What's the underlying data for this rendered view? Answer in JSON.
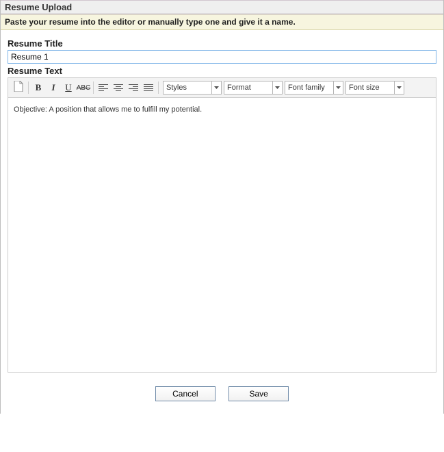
{
  "header": {
    "title": "Resume Upload"
  },
  "instruction": "Paste your resume into the editor or manually type one and give it a name.",
  "form": {
    "title_label": "Resume Title",
    "title_value": "Resume 1",
    "text_label": "Resume Text"
  },
  "toolbar": {
    "new_doc": "New Document",
    "bold": "B",
    "italic": "I",
    "underline": "U",
    "strike": "ABC",
    "styles": "Styles",
    "format": "Format",
    "font_family": "Font family",
    "font_size": "Font size"
  },
  "editor": {
    "content": "Objective:  A position that allows me to fulfill my potential."
  },
  "buttons": {
    "cancel": "Cancel",
    "save": "Save"
  }
}
